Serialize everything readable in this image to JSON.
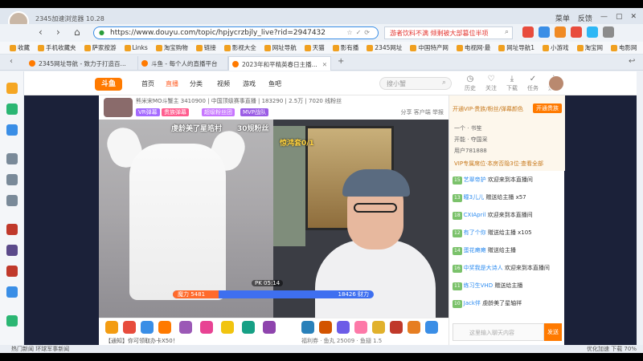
{
  "browser": {
    "title": "2345加速浏览器 10.28",
    "controls": [
      "菜单",
      "反馈",
      "—",
      "▢",
      "✕"
    ],
    "url": "https://www.douyu.com/topic/hpjycrzbjly_live?rid=2947432",
    "search_placeholder": "游者饮料不满 倾剩被大部篡位半项",
    "bookmarks": [
      "收藏",
      "手机收藏夹",
      "萨家按游",
      "Links",
      "淘宝购物",
      "链接",
      "影视大全",
      "网址导航",
      "天猫",
      "影有播",
      "2345网址",
      "中国特产网",
      "电视网·最",
      "网址导航1",
      "小游戏",
      "淘宝网",
      "电影网",
      "美女库"
    ],
    "tabs": [
      "2345网址导航 - 致力于打造百...",
      "斗鱼 - 每个人的直播平台",
      "2023年和平精英春日主播..."
    ],
    "status_left": "热门新闻  环球军事新闻",
    "status_right": "优化加速   下载   70%"
  },
  "site": {
    "logo": "斗鱼",
    "nav": [
      "首页",
      "直播",
      "分类",
      "视频",
      "游戏",
      "鱼吧"
    ],
    "search_placeholder": "搜小蟹",
    "header_icons": [
      "历史",
      "关注",
      "下载",
      "任务",
      "消息"
    ]
  },
  "room": {
    "title": "熊米宋MO斗蟹主  3410900   | 中国顶级赛事直播 | 183290 | 2.5万 | 7020 线粉丝",
    "badges": [
      "VR弹幕",
      "贵族弹幕",
      "超级粉丝团",
      "MVP战队"
    ],
    "actions": "分享   客户端   举报"
  },
  "video": {
    "left_label": "虔龄美了星皓村",
    "left_label2": "30规粉丝",
    "right_label": "惊鸿套0/1",
    "pk_time": "PK 05:14",
    "pk_left": "魔力 5481",
    "pk_right": "18426 财力",
    "pk_left_value": 5481,
    "pk_right_value": 18426
  },
  "giftbar": {
    "notice": "【通知】你可领取办卡X50！",
    "wealth": "福利券 · 鱼丸 25009 · 鱼翅 1.5"
  },
  "chat": {
    "open_noble": "开通VIP·贵族/粉丝/弹幕颜色",
    "open_btn": "开通贵族",
    "noble_rows": [
      "一个 · 书笙",
      "开能 · 夺国采",
      "用户781888"
    ],
    "noble_hint": "VIP专属席位·本房否隐3位·查看全部",
    "lines": [
      {
        "lv": "15",
        "user": "艺翠帝护",
        "text": "欢迎来到本直播间"
      },
      {
        "lv": "13",
        "user": "瞳3儿儿",
        "text": "赠送给主播 x57"
      },
      {
        "lv": "18",
        "user": "CXIApril",
        "text": "欢迎来到本直播间"
      },
      {
        "lv": "12",
        "user": "有了个你",
        "text": "赠送给主播 x105"
      },
      {
        "lv": "14",
        "user": "蛋花瘫瘫",
        "text": "赠送给主播"
      },
      {
        "lv": "16",
        "user": "中奖我是大诗人",
        "text": "欢迎来到本直播间"
      },
      {
        "lv": "11",
        "user": "练习生VHD",
        "text": "赠送给主播"
      },
      {
        "lv": "10",
        "user": "Jack伴",
        "text": "虔龄美了星轴祥"
      }
    ],
    "input_placeholder": "这里输入聊天内容",
    "send": "发送"
  },
  "colors": {
    "accent": "#ff7a00",
    "pk_red": "#ff6a2b",
    "pk_blue": "#3e6ff0",
    "panel_dark": "#1b2139"
  }
}
